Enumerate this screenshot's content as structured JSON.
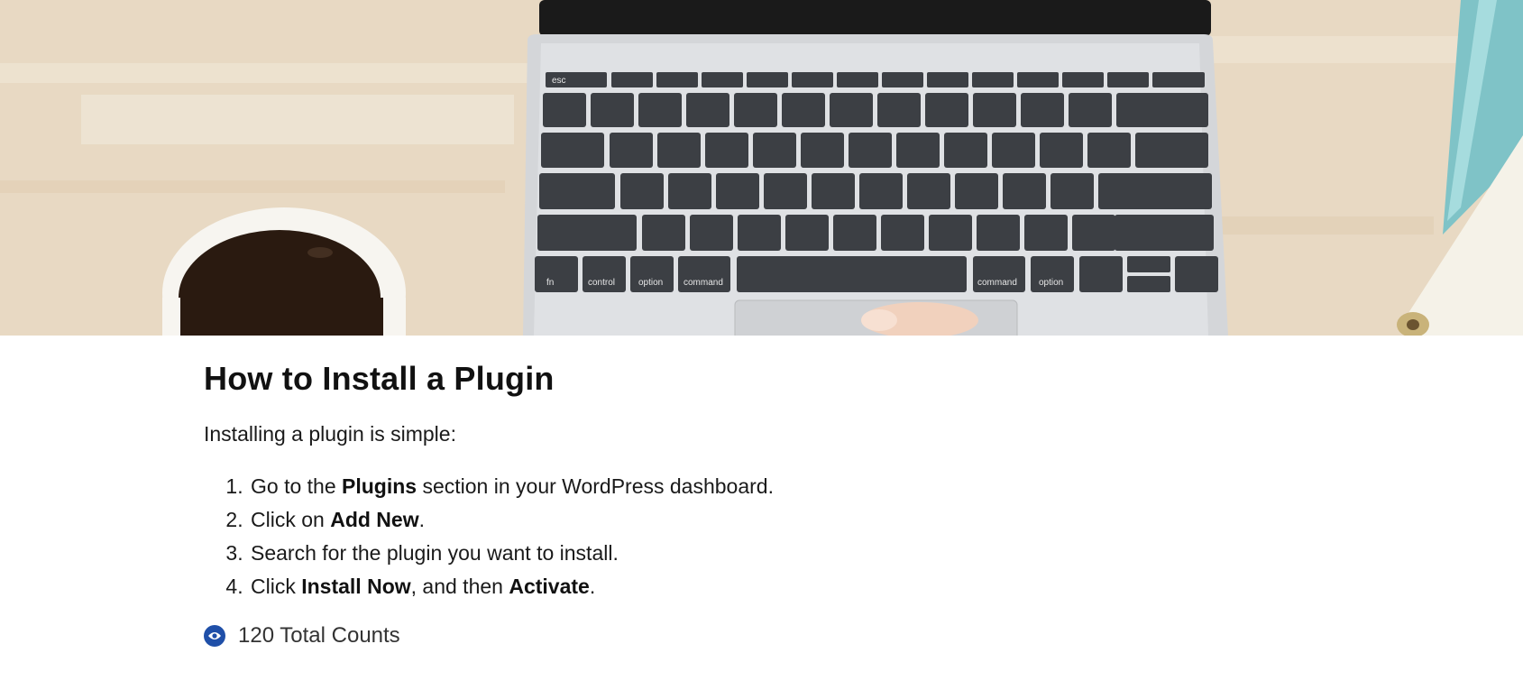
{
  "article": {
    "title": "How to Install a Plugin",
    "intro": "Installing a plugin is simple:",
    "steps": [
      {
        "pre": "Go to the ",
        "bold": "Plugins",
        "post": " section in your WordPress dashboard."
      },
      {
        "pre": "Click on ",
        "bold": "Add New",
        "post": "."
      },
      {
        "pre": "Search for the plugin you want to install.",
        "bold": "",
        "post": ""
      },
      {
        "pre": "Click ",
        "bold": "Install Now",
        "mid": ", and then ",
        "bold2": "Activate",
        "post": "."
      }
    ]
  },
  "views": {
    "count_text": "120 Total Counts",
    "icon": "eye-icon",
    "icon_color": "#1f4fa8"
  },
  "hero": {
    "image": "laptop-keyboard-coffee-photo",
    "key_labels": [
      "esc",
      "fn",
      "control",
      "option",
      "command",
      "command",
      "option"
    ]
  }
}
